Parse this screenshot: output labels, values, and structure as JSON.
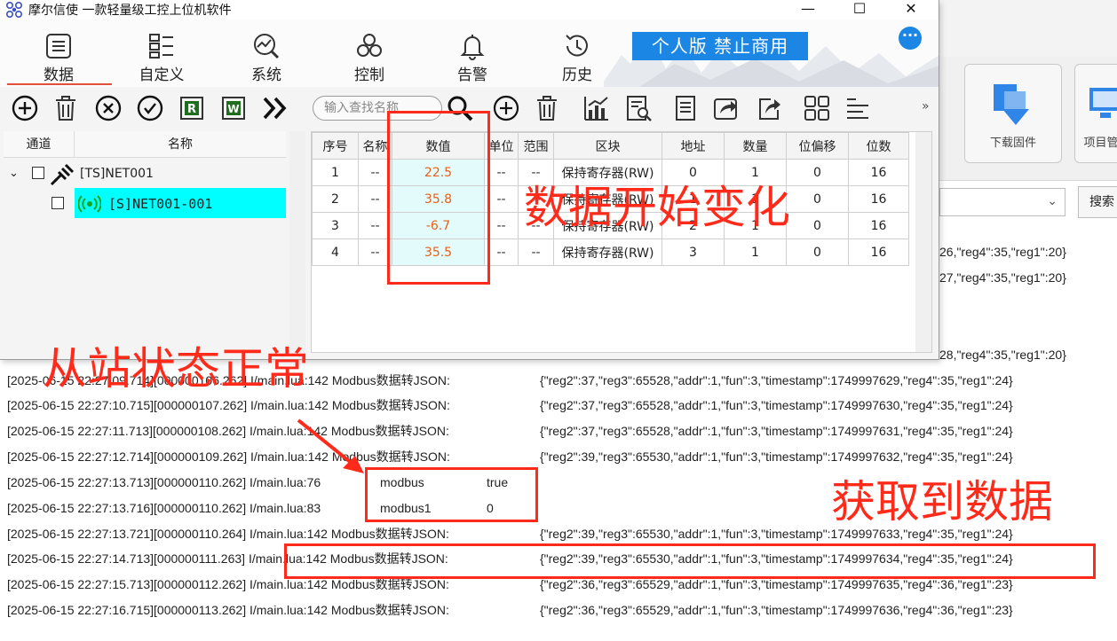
{
  "window": {
    "title": "摩尔信使  一款轻量级工控上位机软件",
    "controls": [
      "—",
      "☐",
      "✕"
    ]
  },
  "nav": [
    {
      "label": "数据",
      "icon": "list-icon"
    },
    {
      "label": "自定义",
      "icon": "grid-icon"
    },
    {
      "label": "系统",
      "icon": "chart-search-icon"
    },
    {
      "label": "控制",
      "icon": "network-icon"
    },
    {
      "label": "告警",
      "icon": "bell-icon"
    },
    {
      "label": "历史",
      "icon": "history-icon"
    }
  ],
  "badge": "个人版  禁止商用",
  "search": {
    "placeholder": "输入查找名称"
  },
  "tree": {
    "headers": [
      "通道",
      "名称"
    ],
    "channel": "[TS]NET001",
    "station": "[S]NET001-001"
  },
  "table": {
    "headers": [
      "序号",
      "名称",
      "数值",
      "单位",
      "范围",
      "区块",
      "地址",
      "数量",
      "位偏移",
      "位数"
    ],
    "rows": [
      [
        "1",
        "--",
        "22.5",
        "--",
        "--",
        "保持寄存器(RW)",
        "0",
        "1",
        "0",
        "16"
      ],
      [
        "2",
        "--",
        "35.8",
        "--",
        "--",
        "保持寄存器(RW)",
        "1",
        "1",
        "0",
        "16"
      ],
      [
        "3",
        "--",
        "-6.7",
        "--",
        "--",
        "保持寄存器(RW)",
        "2",
        "1",
        "0",
        "16"
      ],
      [
        "4",
        "--",
        "35.5",
        "--",
        "--",
        "保持寄存器(RW)",
        "3",
        "1",
        "0",
        "16"
      ]
    ]
  },
  "bg_app": {
    "buttons": [
      "下载固件",
      "项目管"
    ],
    "search_button": "搜索"
  },
  "log": {
    "partial_json_right": [
      "26,\"reg4\":35,\"reg1\":20}",
      "27,\"reg4\":35,\"reg1\":20}",
      "28,\"reg4\":35,\"reg1\":20}"
    ],
    "lines": [
      {
        "prefix": "[2025-06-15 22:27:09.714][000000106.262] I/main.lua:142  Modbus数据转JSON:",
        "json": "{\"reg2\":37,\"reg3\":65528,\"addr\":1,\"fun\":3,\"timestamp\":1749997629,\"reg4\":35,\"reg1\":24}"
      },
      {
        "prefix": "[2025-06-15 22:27:10.715][000000107.262] I/main.lua:142  Modbus数据转JSON:",
        "json": "{\"reg2\":37,\"reg3\":65528,\"addr\":1,\"fun\":3,\"timestamp\":1749997630,\"reg4\":35,\"reg1\":24}"
      },
      {
        "prefix": "[2025-06-15 22:27:11.713][000000108.262] I/main.lua:142  Modbus数据转JSON:",
        "json": "{\"reg2\":37,\"reg3\":65528,\"addr\":1,\"fun\":3,\"timestamp\":1749997631,\"reg4\":35,\"reg1\":24}"
      },
      {
        "prefix": "[2025-06-15 22:27:12.714][000000109.262] I/main.lua:142  Modbus数据转JSON:",
        "json": "{\"reg2\":39,\"reg3\":65530,\"addr\":1,\"fun\":3,\"timestamp\":1749997632,\"reg4\":35,\"reg1\":24}"
      },
      {
        "prefix": "[2025-06-15 22:27:13.713][000000110.262] I/main.lua:76",
        "key": "modbus",
        "val": "true"
      },
      {
        "prefix": "[2025-06-15 22:27:13.716][000000110.262] I/main.lua:83",
        "key": "modbus1",
        "val": "0"
      },
      {
        "prefix": "[2025-06-15 22:27:13.721][000000110.264] I/main.lua:142  Modbus数据转JSON:",
        "json": "{\"reg2\":39,\"reg3\":65530,\"addr\":1,\"fun\":3,\"timestamp\":1749997633,\"reg4\":35,\"reg1\":24}"
      },
      {
        "prefix": "[2025-06-15 22:27:14.713][000000111.263] I/main.lua:142  Modbus数据转JSON:",
        "json": "{\"reg2\":39,\"reg3\":65530,\"addr\":1,\"fun\":3,\"timestamp\":1749997634,\"reg4\":35,\"reg1\":24}"
      },
      {
        "prefix": "[2025-06-15 22:27:15.713][000000112.262] I/main.lua:142  Modbus数据转JSON:",
        "json": "{\"reg2\":36,\"reg3\":65529,\"addr\":1,\"fun\":3,\"timestamp\":1749997635,\"reg4\":36,\"reg1\":23}"
      },
      {
        "prefix": "[2025-06-15 22:27:16.715][000000113.262] I/main.lua:142  Modbus数据转JSON:",
        "json": "{\"reg2\":36,\"reg3\":65529,\"addr\":1,\"fun\":3,\"timestamp\":1749997636,\"reg4\":36,\"reg1\":23}"
      }
    ]
  },
  "annotations": {
    "data_change": "数据开始变化",
    "slave_ok": "从站状态正常",
    "got_data": "获取到数据"
  },
  "colors": {
    "accent_blue": "#1b86e3",
    "annotation_red": "#ff2a1a",
    "selected_node": "#00ffff",
    "value_text": "#e8601a"
  }
}
